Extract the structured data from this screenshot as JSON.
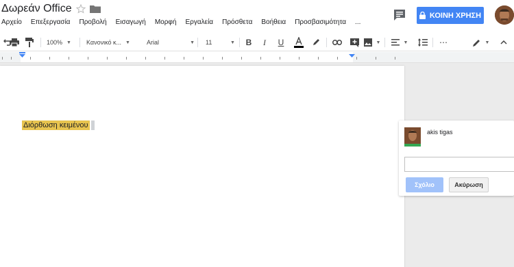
{
  "title_bar": {
    "doc_title": "Δωρεάν Office",
    "share_label": "ΚΟΙΝΗ ΧΡΗΣΗ",
    "colors": {
      "share_bg": "#4285f4"
    }
  },
  "menu": {
    "items": [
      "Αρχείο",
      "Επεξεργασία",
      "Προβολή",
      "Εισαγωγή",
      "Μορφή",
      "Εργαλεία",
      "Πρόσθετα",
      "Βοήθεια",
      "Προσβασιμότητα",
      "..."
    ]
  },
  "toolbar": {
    "zoom": "100%",
    "style": "Κανονικό κ...",
    "font": "Arial",
    "font_size": "11",
    "more": "⋯"
  },
  "document": {
    "text": "Διόρθωση κειμένου",
    "highlight_color": "#e8c44f"
  },
  "comment": {
    "user": "akis tigas",
    "input_value": "",
    "submit_label": "Σχόλιο",
    "cancel_label": "Ακύρωση"
  }
}
